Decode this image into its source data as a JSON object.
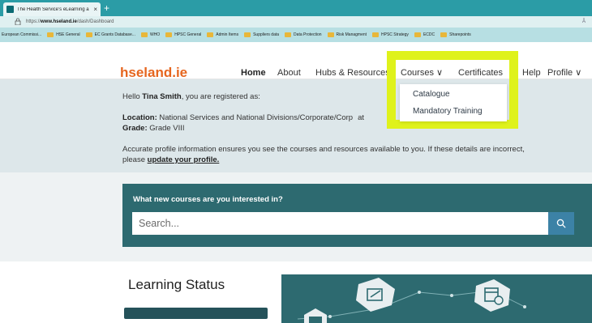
{
  "browser": {
    "tab_title": "The Health Service's eLearning a",
    "tab_close": "×",
    "new_tab": "+",
    "url_prefix": "https://",
    "url_host": "www.hseland.ie",
    "url_path": "/dash/Dashboard",
    "right_text": "Â",
    "bookmarks": [
      {
        "label": "European Commissi...",
        "folder": false
      },
      {
        "label": "HSE General",
        "folder": true
      },
      {
        "label": "EC Grants Database...",
        "folder": true
      },
      {
        "label": "WHO",
        "folder": true
      },
      {
        "label": "HPSC General",
        "folder": true
      },
      {
        "label": "Admin Items",
        "folder": true
      },
      {
        "label": "Suppliers data",
        "folder": true
      },
      {
        "label": "Data Protection",
        "folder": true
      },
      {
        "label": "Risk Managment",
        "folder": true
      },
      {
        "label": "HPSC Strategy",
        "folder": true
      },
      {
        "label": "ECDC",
        "folder": true
      },
      {
        "label": "Sharepoints",
        "folder": true
      }
    ]
  },
  "header": {
    "logo": "hseland.ie",
    "nav": {
      "home": "Home",
      "about": "About",
      "hubs": "Hubs & Resources",
      "courses": "Courses ∨",
      "certificates": "Certificates",
      "help": "Help",
      "profile": "Profile ∨"
    }
  },
  "courses_menu": {
    "items": [
      "Catalogue",
      "Mandatory Training"
    ]
  },
  "greeting": {
    "hello_prefix": "Hello ",
    "user_name": "Tina Smith",
    "hello_suffix": ", you are registered as:",
    "location_label": "Location:",
    "location_value": " National Services and National Divisions/Corporate/Corp",
    "location_tail": "at",
    "grade_label": "Grade:",
    "grade_value": " Grade VIII",
    "notice": "Accurate profile information ensures you see the courses and resources available to you. If these details are incorrect,",
    "notice_prefix": "please ",
    "update_link": "update your profile."
  },
  "search": {
    "heading": "What new courses are you interested in?",
    "placeholder": "Search..."
  },
  "learning": {
    "title": "Learning Status"
  },
  "colors": {
    "accent_orange": "#e6661f",
    "teal": "#2d6a70",
    "highlight": "#dff21b"
  }
}
